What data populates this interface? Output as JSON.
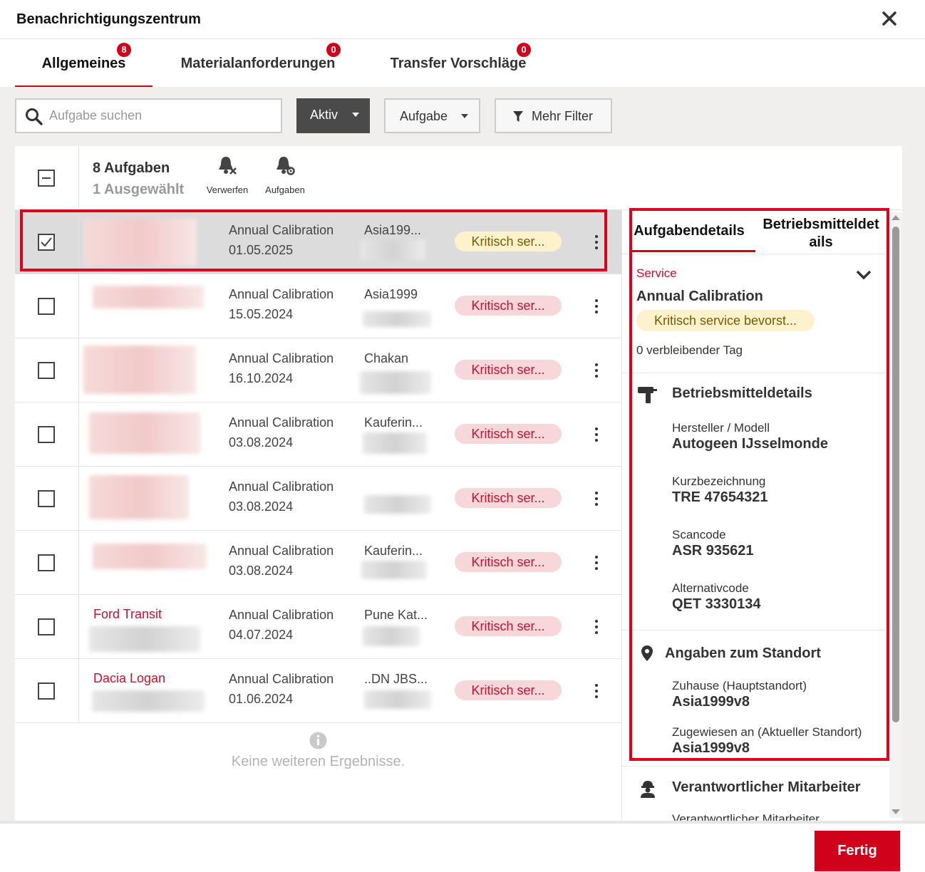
{
  "header": {
    "title": "Benachrichtigungszentrum"
  },
  "tabs": [
    {
      "label": "Allgemeines",
      "count": "8"
    },
    {
      "label": "Materialanforderungen",
      "count": "0"
    },
    {
      "label": "Transfer Vorschläge",
      "count": "0"
    }
  ],
  "filters": {
    "search_placeholder": "Aufgabe suchen",
    "status": "Aktiv",
    "type": "Aufgabe",
    "more": "Mehr Filter"
  },
  "list_header": {
    "count": "8 Aufgaben",
    "selected": "1 Ausgewählt",
    "dismiss": "Verwerfen",
    "tasks": "Aufgaben"
  },
  "rows": [
    {
      "asset": "",
      "task": "Annual Calibration",
      "date": "01.05.2025",
      "location": "Asia199...",
      "status": "Kritisch ser...",
      "selected": true
    },
    {
      "asset": "",
      "task": "Annual Calibration",
      "date": "15.05.2024",
      "location": "Asia1999",
      "status": "Kritisch ser...",
      "selected": false
    },
    {
      "asset": "",
      "task": "Annual Calibration",
      "date": "16.10.2024",
      "location": "Chakan",
      "status": "Kritisch ser...",
      "selected": false
    },
    {
      "asset": "",
      "task": "Annual Calibration",
      "date": "03.08.2024",
      "location": "Kauferin...",
      "status": "Kritisch ser...",
      "selected": false
    },
    {
      "asset": "",
      "task": "Annual Calibration",
      "date": "03.08.2024",
      "location": "",
      "status": "Kritisch ser...",
      "selected": false
    },
    {
      "asset": "",
      "task": "Annual Calibration",
      "date": "03.08.2024",
      "location": "Kauferin...",
      "status": "Kritisch ser...",
      "selected": false
    },
    {
      "asset": "Ford Transit",
      "task": "Annual Calibration",
      "date": "04.07.2024",
      "location": "Pune Kat...",
      "status": "Kritisch ser...",
      "selected": false
    },
    {
      "asset": "Dacia Logan",
      "task": "Annual Calibration",
      "date": "01.06.2024",
      "location": "..DN JBS...",
      "status": "Kritisch ser...",
      "selected": false
    }
  ],
  "no_more": "Keine weiteren Ergebnisse.",
  "detail": {
    "tab_task": "Aufgabendetails",
    "tab_asset_1": "Betriebsmitteldet",
    "tab_asset_2": "ails",
    "category": "Service",
    "title": "Annual Calibration",
    "status": "Kritisch service bevorst...",
    "remaining": "0 verbleibender Tag",
    "asset_section": "Betriebsmitteldetails",
    "manufacturer_label": "Hersteller / Modell",
    "manufacturer_value": "Autogeen IJsselmonde",
    "short_label": "Kurzbezeichnung",
    "short_value": "TRE 47654321",
    "scan_label": "Scancode",
    "scan_value": "ASR 935621",
    "alt_label": "Alternativcode",
    "alt_value": "QET 3330134",
    "location_section": "Angaben zum Standort",
    "home_label": "Zuhause (Hauptstandort)",
    "home_value": "Asia1999v8",
    "assigned_label": "Zugewiesen an (Aktueller Standort)",
    "assigned_value": "Asia1999v8",
    "responsible_section": "Verantwortlicher Mitarbeiter",
    "responsible_label": "Verantwortlicher Mitarbeiter"
  },
  "footer": {
    "done": "Fertig"
  },
  "colors": {
    "accent": "#d0021b",
    "highlight": "#e0001b",
    "dark_button": "#4a4a4a"
  }
}
